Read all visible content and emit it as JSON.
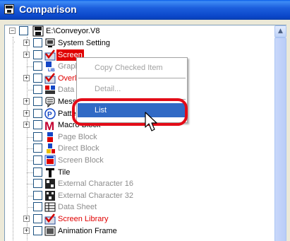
{
  "window": {
    "title": "Comparison"
  },
  "tree": {
    "root": {
      "label": "E:\\Conveyor.V8"
    },
    "items": [
      {
        "label": "System Setting",
        "style": "normal",
        "expand": true,
        "icon": "monitor-icon",
        "checked": false
      },
      {
        "label": "Screen",
        "style": "sel",
        "expand": true,
        "icon": "red-check-icon",
        "checked": true
      },
      {
        "label": "Graphic Library",
        "style": "gray",
        "expand": false,
        "icon": "library-icon",
        "checked": false
      },
      {
        "label": "Overlap Library",
        "style": "red",
        "expand": true,
        "icon": "red-check-icon",
        "checked": true
      },
      {
        "label": "Data Block",
        "style": "gray",
        "expand": false,
        "icon": "data-block-icon",
        "checked": false
      },
      {
        "label": "Message",
        "style": "normal",
        "expand": true,
        "icon": "message-icon",
        "checked": false
      },
      {
        "label": "Pattern",
        "style": "normal",
        "expand": true,
        "icon": "pattern-icon",
        "checked": false
      },
      {
        "label": "Macro Block",
        "style": "normal",
        "expand": true,
        "icon": "macro-icon",
        "checked": false
      },
      {
        "label": "Page Block",
        "style": "gray",
        "expand": false,
        "icon": "page-block-icon",
        "checked": false
      },
      {
        "label": "Direct Block",
        "style": "gray",
        "expand": false,
        "icon": "direct-block-icon",
        "checked": false
      },
      {
        "label": "Screen Block",
        "style": "gray",
        "expand": false,
        "icon": "screen-block-icon",
        "checked": false
      },
      {
        "label": "Tile",
        "style": "normal",
        "expand": false,
        "icon": "tile-icon",
        "checked": false
      },
      {
        "label": "External Character 16",
        "style": "gray",
        "expand": false,
        "icon": "ext-char-16-icon",
        "checked": false
      },
      {
        "label": "External Character 32",
        "style": "gray",
        "expand": false,
        "icon": "ext-char-32-icon",
        "checked": false
      },
      {
        "label": "Data Sheet",
        "style": "gray",
        "expand": false,
        "icon": "data-sheet-icon",
        "checked": false
      },
      {
        "label": "Screen Library",
        "style": "red",
        "expand": true,
        "icon": "red-check-icon",
        "checked": true
      },
      {
        "label": "Animation Frame",
        "style": "normal",
        "expand": true,
        "icon": "animation-icon",
        "checked": false
      }
    ]
  },
  "context_menu": {
    "copy_checked_item": "Copy Checked Item",
    "detail": "Detail...",
    "list": "List"
  },
  "colors": {
    "accent": "#316ac5",
    "highlight_ring": "#e30b17",
    "changed_text": "#e00000"
  }
}
